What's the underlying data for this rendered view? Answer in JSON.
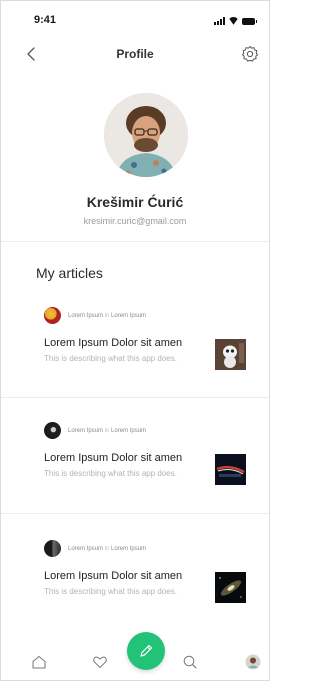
{
  "status_bar": {
    "time": "9:41",
    "icons": [
      "signal-icon",
      "wifi-icon",
      "battery-icon"
    ]
  },
  "nav": {
    "title": "Profile",
    "back_icon": "chevron-left-icon",
    "settings_icon": "gear-icon"
  },
  "profile": {
    "name": "Krešimir Ćurić",
    "email": "kresimir.curic@gmail.com"
  },
  "section_title": "My articles",
  "articles": [
    {
      "author": "Lorem Ipsum",
      "in_word": "in",
      "publication": "Lorem Ipsum",
      "title": "Lorem Ipsum Dolor sit amen",
      "description": "This is describing what this app does."
    },
    {
      "author": "Lorem Ipsum",
      "in_word": "in",
      "publication": "Lorem Ipsum",
      "title": "Lorem Ipsum Dolor sit amen",
      "description": "This is describing what this app does."
    },
    {
      "author": "Lorem Ipsum",
      "in_word": "in",
      "publication": "Lorem Ipsum",
      "title": "Lorem Ipsum Dolor sit amen",
      "description": "This is describing what this app does."
    }
  ],
  "tab_bar": {
    "items": [
      "home-icon",
      "heart-icon",
      "compose-icon",
      "search-icon",
      "profile-avatar-icon"
    ],
    "accent": "#22c279"
  }
}
